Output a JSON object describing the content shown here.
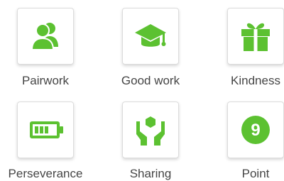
{
  "accent_color": "#5cc131",
  "icon_bg_color": "#ffffff",
  "tiles": [
    {
      "label": "Pairwork",
      "icon": "pair-users-icon"
    },
    {
      "label": "Good work",
      "icon": "graduation-cap-icon"
    },
    {
      "label": "Kindness",
      "icon": "gift-icon"
    },
    {
      "label": "Perseverance",
      "icon": "battery-icon"
    },
    {
      "label": "Sharing",
      "icon": "hands-hexagon-icon"
    },
    {
      "label": "Point",
      "icon": "point-number-icon",
      "value": "9"
    }
  ]
}
